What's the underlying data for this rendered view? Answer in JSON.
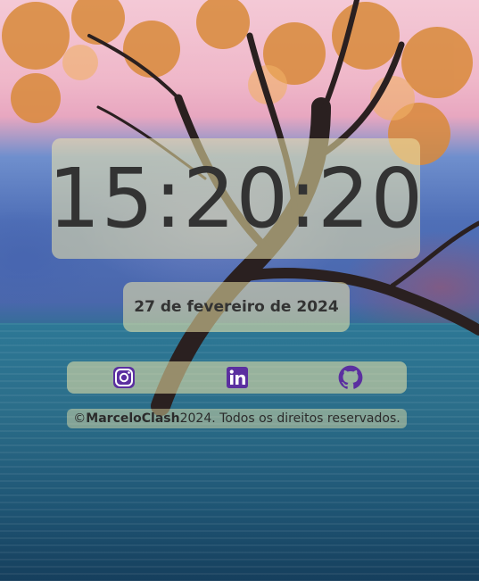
{
  "clock": {
    "time": "15:20:20"
  },
  "date": {
    "text": "27 de fevereiro de 2024"
  },
  "social": {
    "icons": [
      "instagram-icon",
      "linkedin-icon",
      "github-icon"
    ],
    "icon_color": "#5b2fa0"
  },
  "footer": {
    "copyright_symbol": "©",
    "author": "MarceloClash",
    "year": "2024",
    "rights": ". Todos os direitos reservados."
  }
}
